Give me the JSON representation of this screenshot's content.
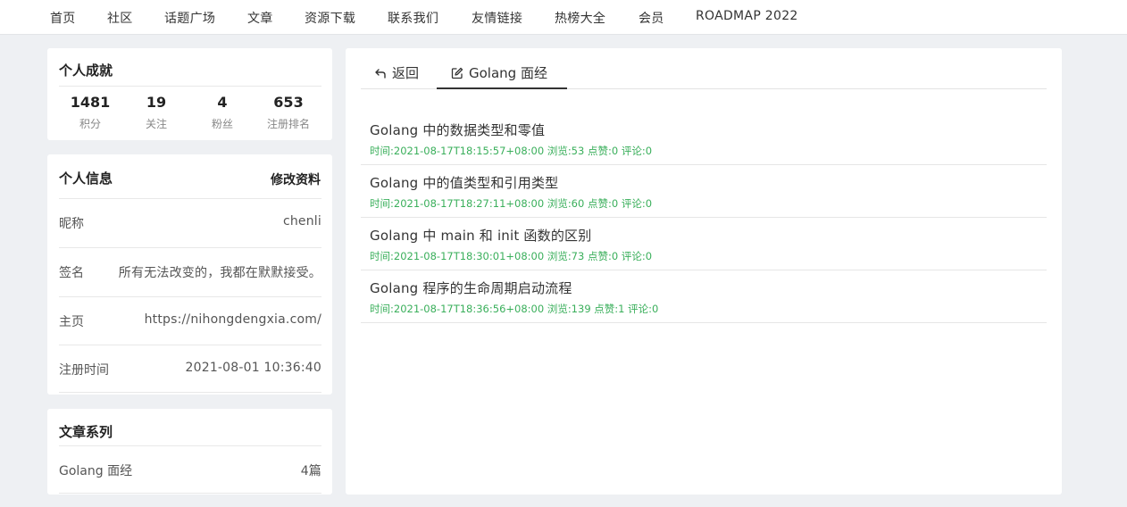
{
  "nav": {
    "items": [
      "首页",
      "社区",
      "话题广场",
      "文章",
      "资源下载",
      "联系我们",
      "友情链接",
      "热榜大全",
      "会员",
      "ROADMAP 2022"
    ]
  },
  "achievements": {
    "title": "个人成就",
    "stats": [
      {
        "value": "1481",
        "label": "积分"
      },
      {
        "value": "19",
        "label": "关注"
      },
      {
        "value": "4",
        "label": "粉丝"
      },
      {
        "value": "653",
        "label": "注册排名"
      }
    ]
  },
  "profile": {
    "title": "个人信息",
    "edit_label": "修改资料",
    "rows": [
      {
        "key": "昵称",
        "value": "chenli"
      },
      {
        "key": "签名",
        "value": "所有无法改变的，我都在默默接受。"
      },
      {
        "key": "主页",
        "value": "https://nihongdengxia.com/"
      },
      {
        "key": "注册时间",
        "value": "2021-08-01 10:36:40"
      }
    ]
  },
  "series": {
    "title": "文章系列",
    "items": [
      {
        "name": "Golang 面经",
        "count": "4篇"
      }
    ]
  },
  "main": {
    "tabs": {
      "back_label": "返回",
      "current_label": "Golang 面经"
    },
    "articles": [
      {
        "title": "Golang 中的数据类型和零值",
        "meta": "时间:2021-08-17T18:15:57+08:00 浏览:53 点赞:0 评论:0"
      },
      {
        "title": "Golang 中的值类型和引用类型",
        "meta": "时间:2021-08-17T18:27:11+08:00 浏览:60 点赞:0 评论:0"
      },
      {
        "title": "Golang 中 main 和 init 函数的区别",
        "meta": "时间:2021-08-17T18:30:01+08:00 浏览:73 点赞:0 评论:0"
      },
      {
        "title": "Golang 程序的生命周期启动流程",
        "meta": "时间:2021-08-17T18:36:56+08:00 浏览:139 点赞:1 评论:0"
      }
    ]
  },
  "colors": {
    "meta_green": "#3aaf5b",
    "page_bg": "#eef0f3"
  }
}
